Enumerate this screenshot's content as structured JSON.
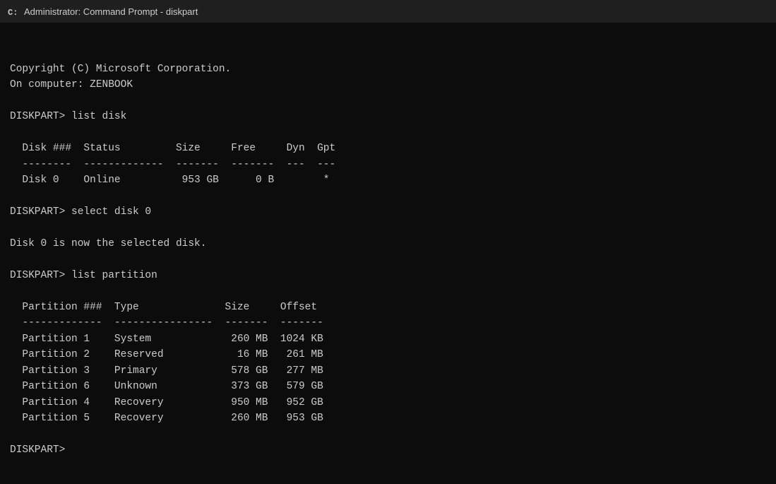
{
  "titleBar": {
    "title": "Administrator: Command Prompt - diskpart",
    "icon": "cmd-icon"
  },
  "terminal": {
    "lines": [
      "",
      "Copyright (C) Microsoft Corporation.",
      "On computer: ZENBOOK",
      "",
      "DISKPART> list disk",
      "",
      "  Disk ###  Status         Size     Free     Dyn  Gpt",
      "  --------  -------------  -------  -------  ---  ---",
      "  Disk 0    Online          953 GB      0 B        *",
      "",
      "DISKPART> select disk 0",
      "",
      "Disk 0 is now the selected disk.",
      "",
      "DISKPART> list partition",
      "",
      "  Partition ###  Type              Size     Offset",
      "  -------------  ----------------  -------  -------",
      "  Partition 1    System             260 MB  1024 KB",
      "  Partition 2    Reserved            16 MB   261 MB",
      "  Partition 3    Primary            578 GB   277 MB",
      "  Partition 6    Unknown            373 GB   579 GB",
      "  Partition 4    Recovery           950 MB   952 GB",
      "  Partition 5    Recovery           260 MB   953 GB",
      "",
      "DISKPART> "
    ]
  }
}
